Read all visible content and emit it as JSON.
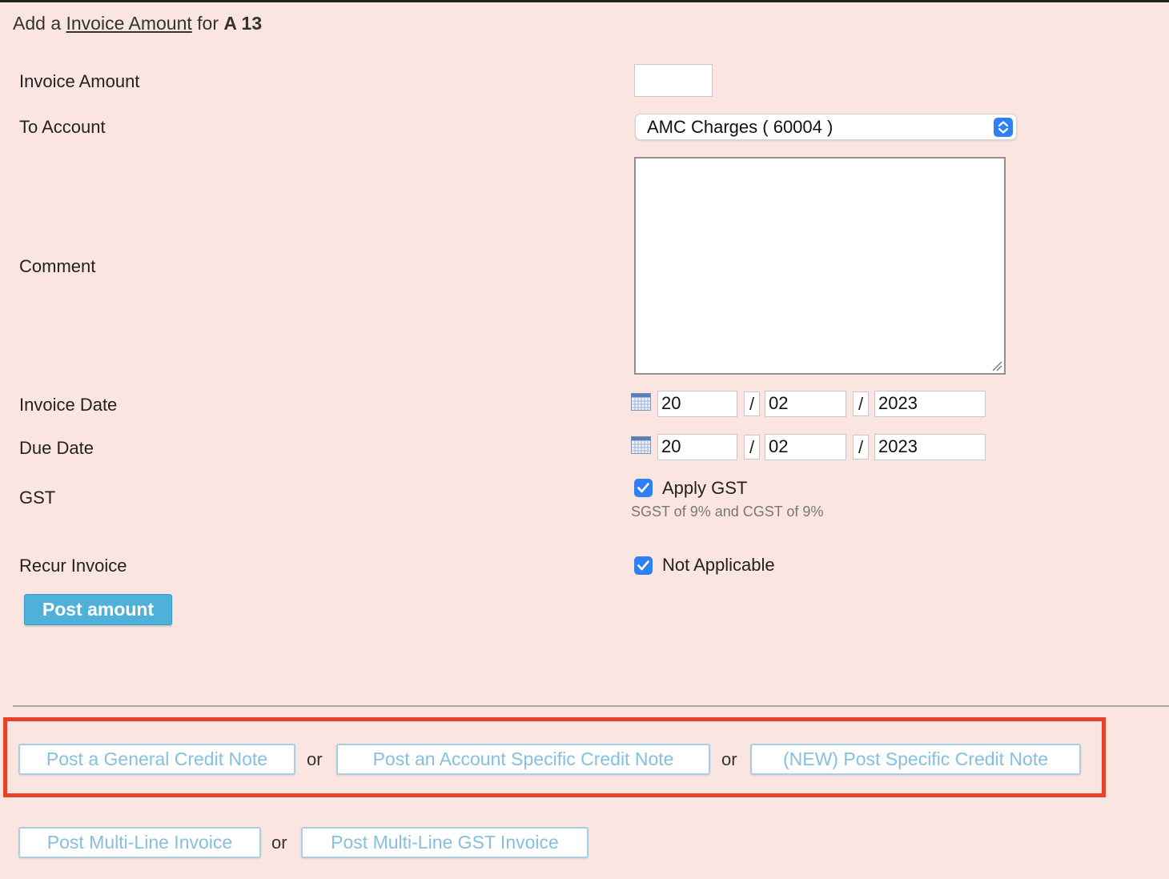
{
  "heading": {
    "prefix": "Add a",
    "link": "Invoice Amount",
    "middle": "for",
    "entity": "A 13"
  },
  "form": {
    "invoice_amount": {
      "label": "Invoice Amount",
      "value": ""
    },
    "to_account": {
      "label": "To Account",
      "selected": "AMC Charges ( 60004 )"
    },
    "comment": {
      "label": "Comment",
      "value": ""
    },
    "invoice_date": {
      "label": "Invoice Date",
      "day": "20",
      "sep": "/",
      "month": "02",
      "year": "2023"
    },
    "due_date": {
      "label": "Due Date",
      "day": "20",
      "sep": "/",
      "month": "02",
      "year": "2023"
    },
    "gst": {
      "label": "GST",
      "checkbox_label": "Apply GST",
      "checked": true,
      "note": "SGST of 9% and CGST of 9%"
    },
    "recur": {
      "label": "Recur Invoice",
      "checkbox_label": "Not Applicable",
      "checked": true
    },
    "submit_label": "Post amount"
  },
  "actions": {
    "row1": [
      "Post a General Credit Note",
      "Post an Account Specific Credit Note",
      "(NEW) Post Specific Credit Note"
    ],
    "row2": [
      "Post Multi-Line Invoice",
      "Post Multi-Line GST Invoice"
    ],
    "or": "or"
  },
  "colors": {
    "background": "#fae5e0",
    "primary_button": "#4db1d9",
    "link_button_text": "#86bfe0",
    "checkbox": "#2f7ff5",
    "highlight": "#e8412c"
  }
}
